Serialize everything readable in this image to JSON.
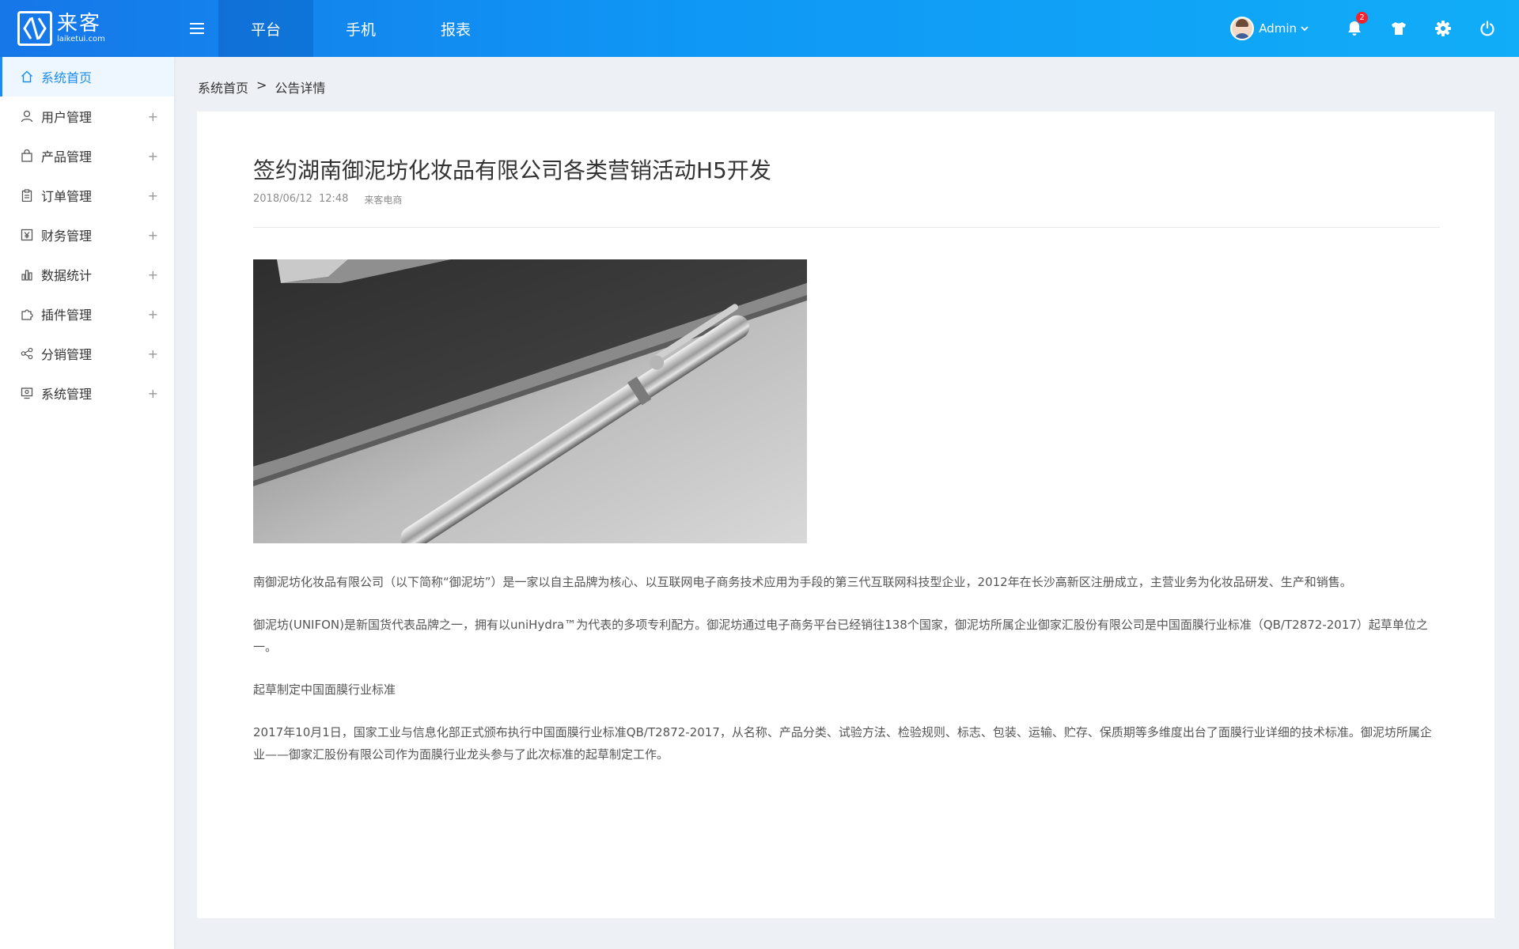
{
  "logo": {
    "name": "来客",
    "url": "laiketui.com"
  },
  "nav": {
    "tabs": [
      {
        "label": "平台"
      },
      {
        "label": "手机"
      },
      {
        "label": "报表"
      }
    ]
  },
  "user": {
    "name": "Admin",
    "notification_count": "2"
  },
  "sidebar": {
    "items": [
      {
        "label": "系统首页",
        "icon": "home-icon"
      },
      {
        "label": "用户管理",
        "icon": "user-icon"
      },
      {
        "label": "产品管理",
        "icon": "bag-icon"
      },
      {
        "label": "订单管理",
        "icon": "clipboard-icon"
      },
      {
        "label": "财务管理",
        "icon": "yen-icon"
      },
      {
        "label": "数据统计",
        "icon": "bar-chart-icon"
      },
      {
        "label": "插件管理",
        "icon": "puzzle-icon"
      },
      {
        "label": "分销管理",
        "icon": "share-icon"
      },
      {
        "label": "系统管理",
        "icon": "monitor-icon"
      }
    ],
    "expand_symbol": "+"
  },
  "breadcrumb": {
    "home": "系统首页",
    "separator": ">",
    "current": "公告详情"
  },
  "article": {
    "title": "签约湖南御泥坊化妆品有限公司各类营销活动H5开发",
    "date": "2018/06/12",
    "time": "12:48",
    "author": "来客电商",
    "paragraphs": [
      "南御泥坊化妆品有限公司（以下简称“御泥坊”）是一家以自主品牌为核心、以互联网电子商务技术应用为手段的第三代互联网科技型企业，2012年在长沙高新区注册成立，主营业务为化妆品研发、生产和销售。",
      "御泥坊(UNIFON)是新国货代表品牌之一，拥有以uniHydra™为代表的多项专利配方。御泥坊通过电子商务平台已经销往138个国家，御泥坊所属企业御家汇股份有限公司是中国面膜行业标准（QB/T2872-2017）起草单位之一。",
      "起草制定中国面膜行业标准",
      "2017年10月1日，国家工业与信息化部正式颁布执行中国面膜行业标准QB/T2872-2017，从名称、产品分类、试验方法、检验规则、标志、包装、运输、贮存、保质期等多维度出台了面膜行业详细的技术标准。御泥坊所属企业——御家汇股份有限公司作为面膜行业龙头参与了此次标准的起草制定工作。"
    ]
  },
  "colors": {
    "accent": "#1a8cf0",
    "topbar_start": "#1677e8",
    "topbar_end": "#11adf8",
    "background": "#edf0f5"
  }
}
